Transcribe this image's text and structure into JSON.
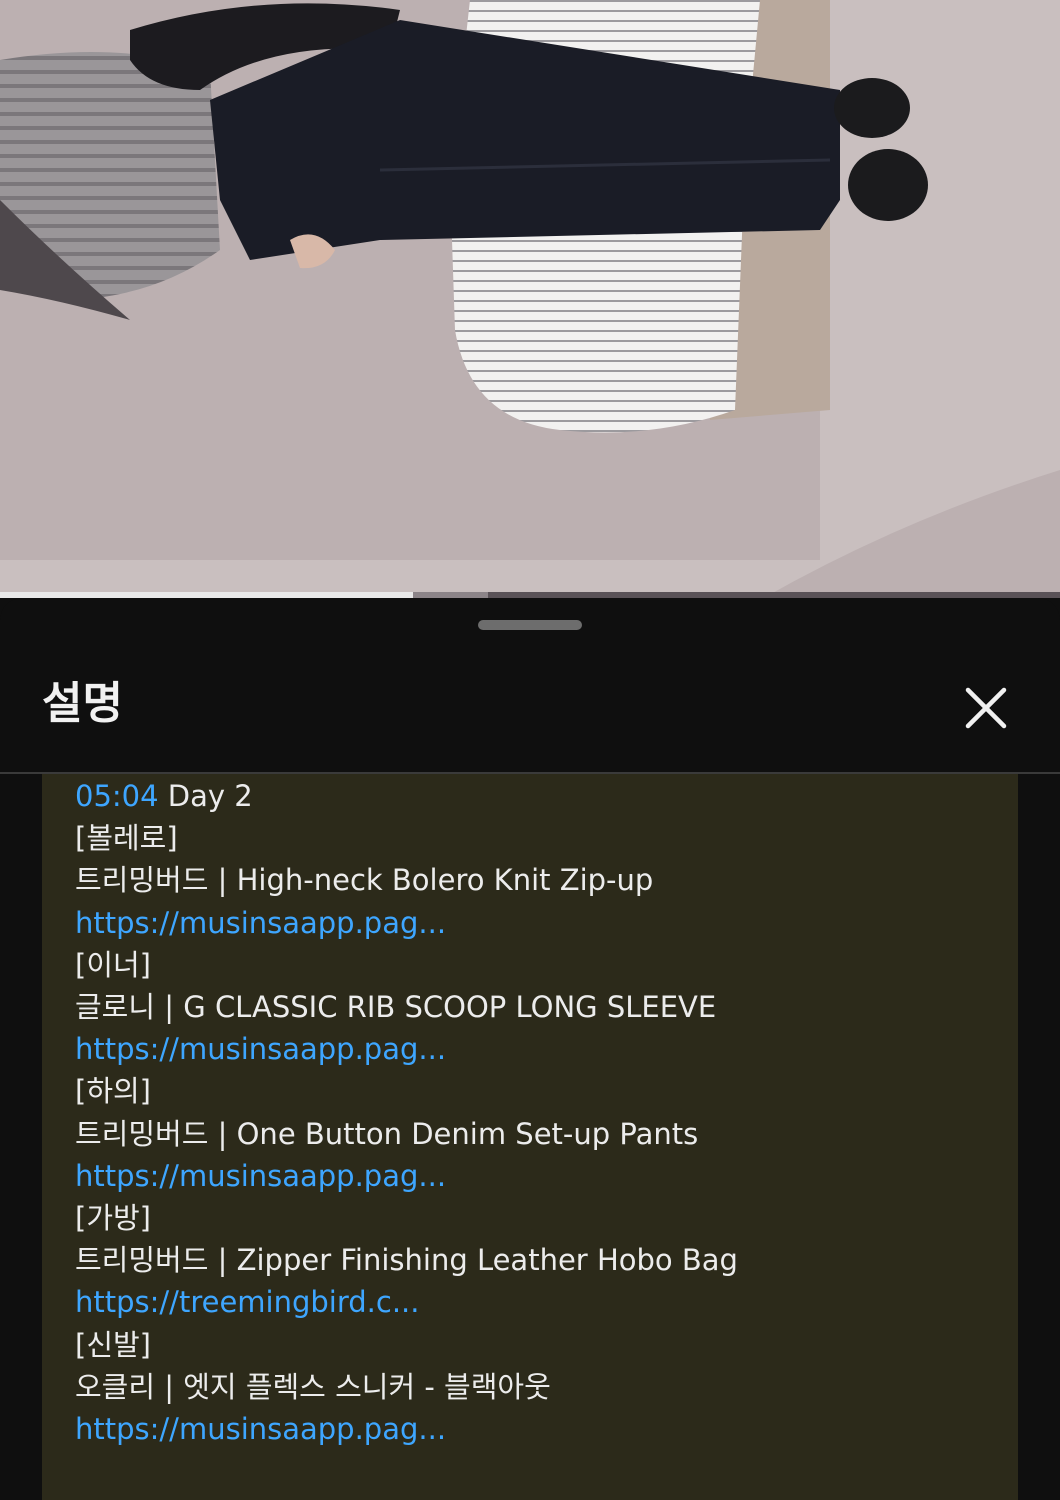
{
  "video": {
    "colors": {
      "background": "#bdb1b2",
      "progress": "#e9e9e9",
      "track": "#5a5257"
    },
    "progress_fraction": 0.39,
    "buffered_fraction": 0.46
  },
  "sheet": {
    "title": "설명",
    "close_icon": "close-icon",
    "description": {
      "timestamp": "05:04",
      "timestamp_suffix": " Day 2",
      "lines": [
        {
          "text": "[볼레로]",
          "type": "text"
        },
        {
          "text": "트리밍버드 | High-neck Bolero Knit Zip-up",
          "type": "text"
        },
        {
          "text": "https://musinsaapp.pag...",
          "type": "link"
        },
        {
          "text": "[이너]",
          "type": "text"
        },
        {
          "text": "글로니 | G CLASSIC RIB SCOOP LONG SLEEVE",
          "type": "text"
        },
        {
          "text": "https://musinsaapp.pag...",
          "type": "link"
        },
        {
          "text": "[하의]",
          "type": "text"
        },
        {
          "text": "트리밍버드 | One Button Denim Set-up Pants",
          "type": "text"
        },
        {
          "text": "https://musinsaapp.pag...",
          "type": "link"
        },
        {
          "text": "[가방]",
          "type": "text"
        },
        {
          "text": "트리밍버드 | Zipper Finishing Leather Hobo Bag",
          "type": "text"
        },
        {
          "text": "https://treemingbird.c...",
          "type": "link"
        },
        {
          "text": "[신발]",
          "type": "text"
        },
        {
          "text": "오클리 | 엣지 플렉스 스니커 - 블랙아웃",
          "type": "text"
        },
        {
          "text": "https://musinsaapp.pag...",
          "type": "link"
        }
      ]
    }
  }
}
